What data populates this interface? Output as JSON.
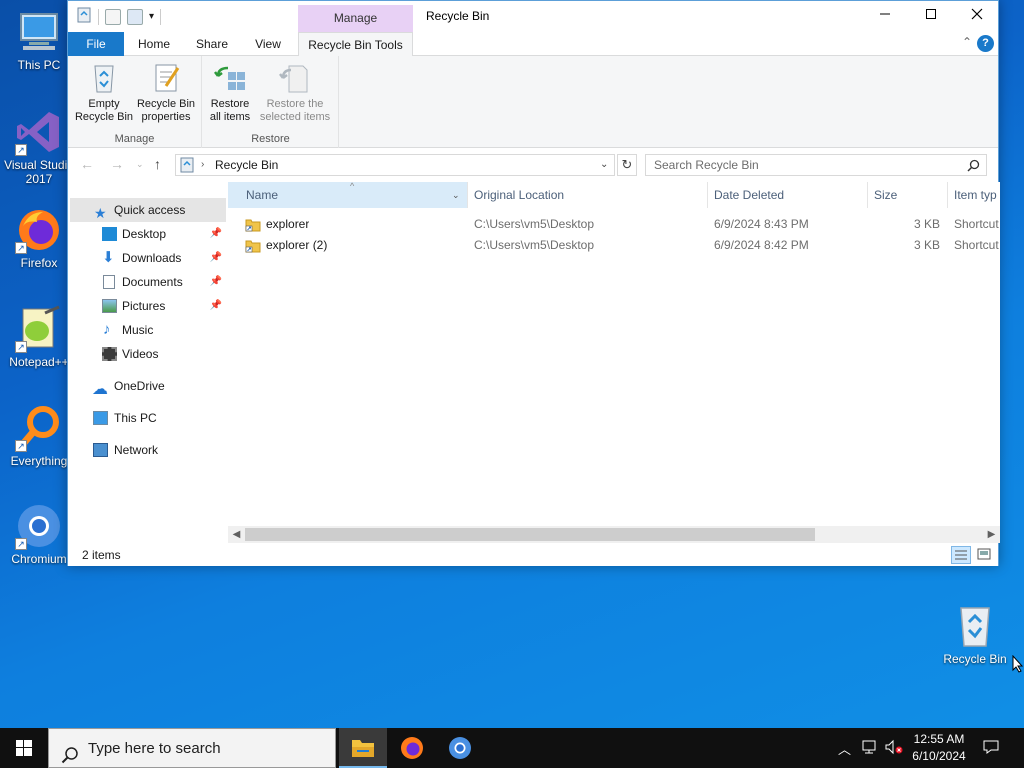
{
  "desktop": {
    "icons": [
      {
        "label": "This PC"
      },
      {
        "label": "Visual Studio 2017"
      },
      {
        "label": "Firefox"
      },
      {
        "label": "Notepad++"
      },
      {
        "label": "Everything"
      },
      {
        "label": "Chromium"
      },
      {
        "label": "Recycle Bin"
      }
    ]
  },
  "window": {
    "title": "Recycle Bin",
    "context_tab_group": "Manage",
    "tabs": [
      "File",
      "Home",
      "Share",
      "View",
      "Recycle Bin Tools"
    ],
    "help_label": "?",
    "ribbon": {
      "groups": [
        {
          "label": "Manage",
          "buttons": [
            {
              "label_line1": "Empty",
              "label_line2": "Recycle Bin"
            },
            {
              "label_line1": "Recycle Bin",
              "label_line2": "properties"
            }
          ]
        },
        {
          "label": "Restore",
          "buttons": [
            {
              "label_line1": "Restore",
              "label_line2": "all items"
            },
            {
              "label_line1": "Restore the",
              "label_line2": "selected items"
            }
          ]
        }
      ]
    },
    "address": {
      "path": "Recycle Bin",
      "search_placeholder": "Search Recycle Bin"
    },
    "nav_pane": {
      "quick_access": "Quick access",
      "items": [
        {
          "label": "Desktop",
          "pinned": true
        },
        {
          "label": "Downloads",
          "pinned": true
        },
        {
          "label": "Documents",
          "pinned": true
        },
        {
          "label": "Pictures",
          "pinned": true
        },
        {
          "label": "Music",
          "pinned": false
        },
        {
          "label": "Videos",
          "pinned": false
        }
      ],
      "onedrive": "OneDrive",
      "this_pc": "This PC",
      "network": "Network"
    },
    "columns": [
      "Name",
      "Original Location",
      "Date Deleted",
      "Size",
      "Item typ"
    ],
    "files": [
      {
        "name": "explorer",
        "location": "C:\\Users\\vm5\\Desktop",
        "date": "6/9/2024 8:43 PM",
        "size": "3 KB",
        "type": "Shortcut"
      },
      {
        "name": "explorer (2)",
        "location": "C:\\Users\\vm5\\Desktop",
        "date": "6/9/2024 8:42 PM",
        "size": "3 KB",
        "type": "Shortcut"
      }
    ],
    "status": "2 items"
  },
  "taskbar": {
    "search_placeholder": "Type here to search",
    "time": "12:55 AM",
    "date": "6/10/2024"
  },
  "colors": {
    "accent": "#1979ca",
    "manage_context": "#e8d1f5",
    "selection": "#cce8ff"
  }
}
